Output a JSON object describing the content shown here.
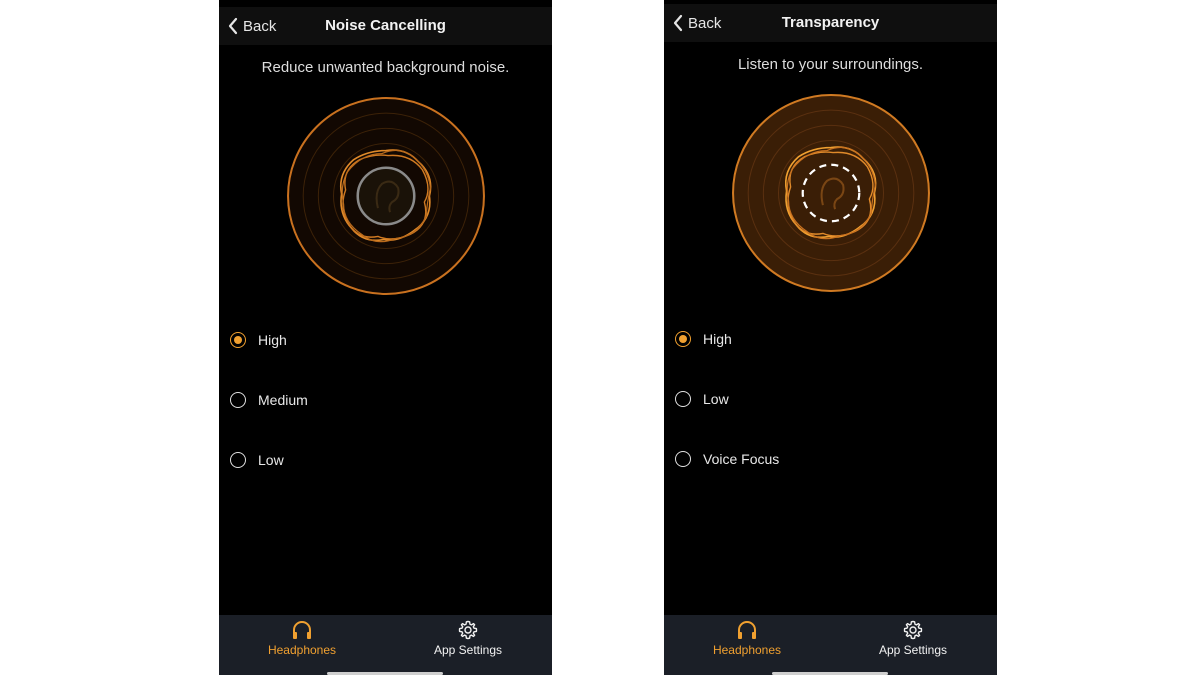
{
  "colors": {
    "accent": "#f0a030",
    "background": "#000000",
    "tabbar": "#1b1f27"
  },
  "screens": [
    {
      "back_label": "Back",
      "title": "Noise Cancelling",
      "subtitle": "Reduce unwanted background noise.",
      "options": [
        {
          "label": "High",
          "selected": true
        },
        {
          "label": "Medium",
          "selected": false
        },
        {
          "label": "Low",
          "selected": false
        }
      ]
    },
    {
      "back_label": "Back",
      "title": "Transparency",
      "subtitle": "Listen to your surroundings.",
      "options": [
        {
          "label": "High",
          "selected": true
        },
        {
          "label": "Low",
          "selected": false
        },
        {
          "label": "Voice Focus",
          "selected": false
        }
      ]
    }
  ],
  "tabbar": {
    "tabs": [
      {
        "label": "Headphones",
        "icon": "headphones-icon",
        "active": true
      },
      {
        "label": "App Settings",
        "icon": "gear-icon",
        "active": false
      }
    ]
  }
}
